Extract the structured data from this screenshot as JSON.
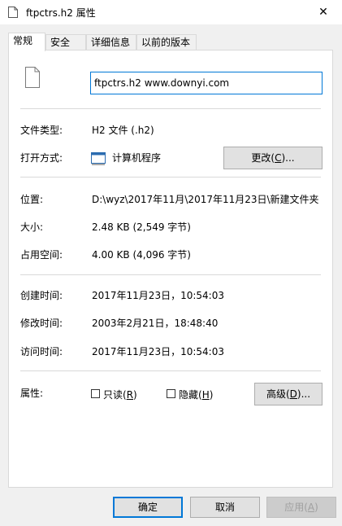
{
  "window": {
    "title": "ftpctrs.h2 属性",
    "close_glyph": "✕"
  },
  "tabs": [
    {
      "label": "常规",
      "active": true
    },
    {
      "label": "安全",
      "active": false
    },
    {
      "label": "详细信息",
      "active": false
    },
    {
      "label": "以前的版本",
      "active": false
    }
  ],
  "general": {
    "file_name": "ftpctrs.h2 www.downyi.com",
    "file_type_label": "文件类型:",
    "file_type_value": "H2 文件 (.h2)",
    "open_with_label": "打开方式:",
    "open_with_value": "计算机程序",
    "change_button_text": "更改(",
    "change_button_key": "C",
    "change_button_suffix": ")...",
    "location_label": "位置:",
    "location_value": "D:\\wyz\\2017年11月\\2017年11月23日\\新建文件夹",
    "size_label": "大小:",
    "size_value": "2.48 KB (2,549 字节)",
    "size_on_disk_label": "占用空间:",
    "size_on_disk_value": "4.00 KB (4,096 字节)",
    "created_label": "创建时间:",
    "created_value": "2017年11月23日，10:54:03",
    "modified_label": "修改时间:",
    "modified_value": "2003年2月21日，18:48:40",
    "accessed_label": "访问时间:",
    "accessed_value": "2017年11月23日，10:54:03",
    "attributes_label": "属性:",
    "readonly_text": "只读(",
    "readonly_key": "R",
    "hidden_text": "隐藏(",
    "hidden_key": "H",
    "close_paren": ")",
    "advanced_text": "高级(",
    "advanced_key": "D",
    "advanced_suffix": ")..."
  },
  "footer": {
    "ok": "确定",
    "cancel": "取消",
    "apply_text": "应用(",
    "apply_key": "A",
    "apply_suffix": ")"
  }
}
